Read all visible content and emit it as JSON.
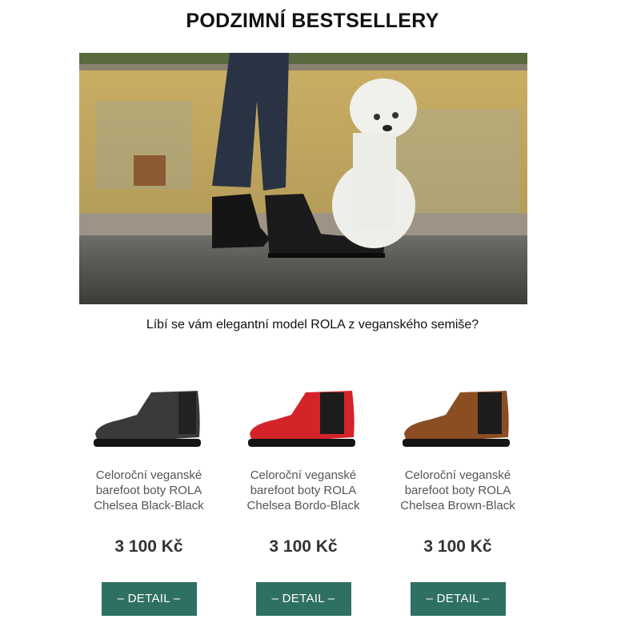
{
  "header": {
    "title": "PODZIMNÍ BESTSELLERY"
  },
  "hero": {
    "alt_subject": "boots-and-white-dog-photo"
  },
  "intro": {
    "text": "Líbí se vám elegantní model ROLA z veganského semiše?"
  },
  "products": [
    {
      "name": "Celoroční veganské barefoot boty ROLA Chelsea Black-Black",
      "price": "3 100 Kč",
      "button": "– DETAIL –",
      "upper_color": "#3a3a3a",
      "panel_color": "#222222"
    },
    {
      "name": "Celoroční veganské barefoot boty ROLA Chelsea Bordo-Black",
      "price": "3 100 Kč",
      "button": "– DETAIL –",
      "upper_color": "#d4242a",
      "panel_color": "#1c1c1c"
    },
    {
      "name": "Celoroční veganské barefoot boty ROLA Chelsea Brown-Black",
      "price": "3 100 Kč",
      "button": "– DETAIL –",
      "upper_color": "#8a4e22",
      "panel_color": "#1c1c1c"
    }
  ],
  "colors": {
    "button_bg": "#2e7062",
    "button_text": "#ffffff",
    "sole": "#141414"
  }
}
